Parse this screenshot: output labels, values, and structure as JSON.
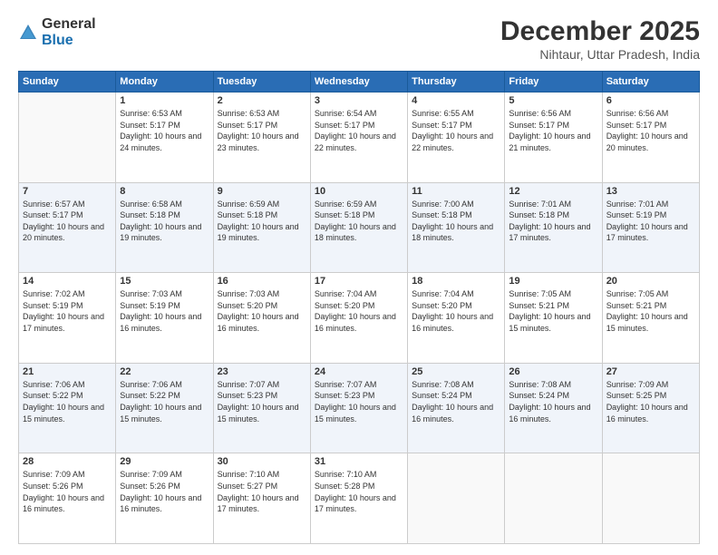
{
  "logo": {
    "general": "General",
    "blue": "Blue"
  },
  "header": {
    "month": "December 2025",
    "location": "Nihtaur, Uttar Pradesh, India"
  },
  "days_of_week": [
    "Sunday",
    "Monday",
    "Tuesday",
    "Wednesday",
    "Thursday",
    "Friday",
    "Saturday"
  ],
  "weeks": [
    [
      {
        "day": "",
        "sunrise": "",
        "sunset": "",
        "daylight": ""
      },
      {
        "day": "1",
        "sunrise": "Sunrise: 6:53 AM",
        "sunset": "Sunset: 5:17 PM",
        "daylight": "Daylight: 10 hours and 24 minutes."
      },
      {
        "day": "2",
        "sunrise": "Sunrise: 6:53 AM",
        "sunset": "Sunset: 5:17 PM",
        "daylight": "Daylight: 10 hours and 23 minutes."
      },
      {
        "day": "3",
        "sunrise": "Sunrise: 6:54 AM",
        "sunset": "Sunset: 5:17 PM",
        "daylight": "Daylight: 10 hours and 22 minutes."
      },
      {
        "day": "4",
        "sunrise": "Sunrise: 6:55 AM",
        "sunset": "Sunset: 5:17 PM",
        "daylight": "Daylight: 10 hours and 22 minutes."
      },
      {
        "day": "5",
        "sunrise": "Sunrise: 6:56 AM",
        "sunset": "Sunset: 5:17 PM",
        "daylight": "Daylight: 10 hours and 21 minutes."
      },
      {
        "day": "6",
        "sunrise": "Sunrise: 6:56 AM",
        "sunset": "Sunset: 5:17 PM",
        "daylight": "Daylight: 10 hours and 20 minutes."
      }
    ],
    [
      {
        "day": "7",
        "sunrise": "Sunrise: 6:57 AM",
        "sunset": "Sunset: 5:17 PM",
        "daylight": "Daylight: 10 hours and 20 minutes."
      },
      {
        "day": "8",
        "sunrise": "Sunrise: 6:58 AM",
        "sunset": "Sunset: 5:18 PM",
        "daylight": "Daylight: 10 hours and 19 minutes."
      },
      {
        "day": "9",
        "sunrise": "Sunrise: 6:59 AM",
        "sunset": "Sunset: 5:18 PM",
        "daylight": "Daylight: 10 hours and 19 minutes."
      },
      {
        "day": "10",
        "sunrise": "Sunrise: 6:59 AM",
        "sunset": "Sunset: 5:18 PM",
        "daylight": "Daylight: 10 hours and 18 minutes."
      },
      {
        "day": "11",
        "sunrise": "Sunrise: 7:00 AM",
        "sunset": "Sunset: 5:18 PM",
        "daylight": "Daylight: 10 hours and 18 minutes."
      },
      {
        "day": "12",
        "sunrise": "Sunrise: 7:01 AM",
        "sunset": "Sunset: 5:18 PM",
        "daylight": "Daylight: 10 hours and 17 minutes."
      },
      {
        "day": "13",
        "sunrise": "Sunrise: 7:01 AM",
        "sunset": "Sunset: 5:19 PM",
        "daylight": "Daylight: 10 hours and 17 minutes."
      }
    ],
    [
      {
        "day": "14",
        "sunrise": "Sunrise: 7:02 AM",
        "sunset": "Sunset: 5:19 PM",
        "daylight": "Daylight: 10 hours and 17 minutes."
      },
      {
        "day": "15",
        "sunrise": "Sunrise: 7:03 AM",
        "sunset": "Sunset: 5:19 PM",
        "daylight": "Daylight: 10 hours and 16 minutes."
      },
      {
        "day": "16",
        "sunrise": "Sunrise: 7:03 AM",
        "sunset": "Sunset: 5:20 PM",
        "daylight": "Daylight: 10 hours and 16 minutes."
      },
      {
        "day": "17",
        "sunrise": "Sunrise: 7:04 AM",
        "sunset": "Sunset: 5:20 PM",
        "daylight": "Daylight: 10 hours and 16 minutes."
      },
      {
        "day": "18",
        "sunrise": "Sunrise: 7:04 AM",
        "sunset": "Sunset: 5:20 PM",
        "daylight": "Daylight: 10 hours and 16 minutes."
      },
      {
        "day": "19",
        "sunrise": "Sunrise: 7:05 AM",
        "sunset": "Sunset: 5:21 PM",
        "daylight": "Daylight: 10 hours and 15 minutes."
      },
      {
        "day": "20",
        "sunrise": "Sunrise: 7:05 AM",
        "sunset": "Sunset: 5:21 PM",
        "daylight": "Daylight: 10 hours and 15 minutes."
      }
    ],
    [
      {
        "day": "21",
        "sunrise": "Sunrise: 7:06 AM",
        "sunset": "Sunset: 5:22 PM",
        "daylight": "Daylight: 10 hours and 15 minutes."
      },
      {
        "day": "22",
        "sunrise": "Sunrise: 7:06 AM",
        "sunset": "Sunset: 5:22 PM",
        "daylight": "Daylight: 10 hours and 15 minutes."
      },
      {
        "day": "23",
        "sunrise": "Sunrise: 7:07 AM",
        "sunset": "Sunset: 5:23 PM",
        "daylight": "Daylight: 10 hours and 15 minutes."
      },
      {
        "day": "24",
        "sunrise": "Sunrise: 7:07 AM",
        "sunset": "Sunset: 5:23 PM",
        "daylight": "Daylight: 10 hours and 15 minutes."
      },
      {
        "day": "25",
        "sunrise": "Sunrise: 7:08 AM",
        "sunset": "Sunset: 5:24 PM",
        "daylight": "Daylight: 10 hours and 16 minutes."
      },
      {
        "day": "26",
        "sunrise": "Sunrise: 7:08 AM",
        "sunset": "Sunset: 5:24 PM",
        "daylight": "Daylight: 10 hours and 16 minutes."
      },
      {
        "day": "27",
        "sunrise": "Sunrise: 7:09 AM",
        "sunset": "Sunset: 5:25 PM",
        "daylight": "Daylight: 10 hours and 16 minutes."
      }
    ],
    [
      {
        "day": "28",
        "sunrise": "Sunrise: 7:09 AM",
        "sunset": "Sunset: 5:26 PM",
        "daylight": "Daylight: 10 hours and 16 minutes."
      },
      {
        "day": "29",
        "sunrise": "Sunrise: 7:09 AM",
        "sunset": "Sunset: 5:26 PM",
        "daylight": "Daylight: 10 hours and 16 minutes."
      },
      {
        "day": "30",
        "sunrise": "Sunrise: 7:10 AM",
        "sunset": "Sunset: 5:27 PM",
        "daylight": "Daylight: 10 hours and 17 minutes."
      },
      {
        "day": "31",
        "sunrise": "Sunrise: 7:10 AM",
        "sunset": "Sunset: 5:28 PM",
        "daylight": "Daylight: 10 hours and 17 minutes."
      },
      {
        "day": "",
        "sunrise": "",
        "sunset": "",
        "daylight": ""
      },
      {
        "day": "",
        "sunrise": "",
        "sunset": "",
        "daylight": ""
      },
      {
        "day": "",
        "sunrise": "",
        "sunset": "",
        "daylight": ""
      }
    ]
  ]
}
